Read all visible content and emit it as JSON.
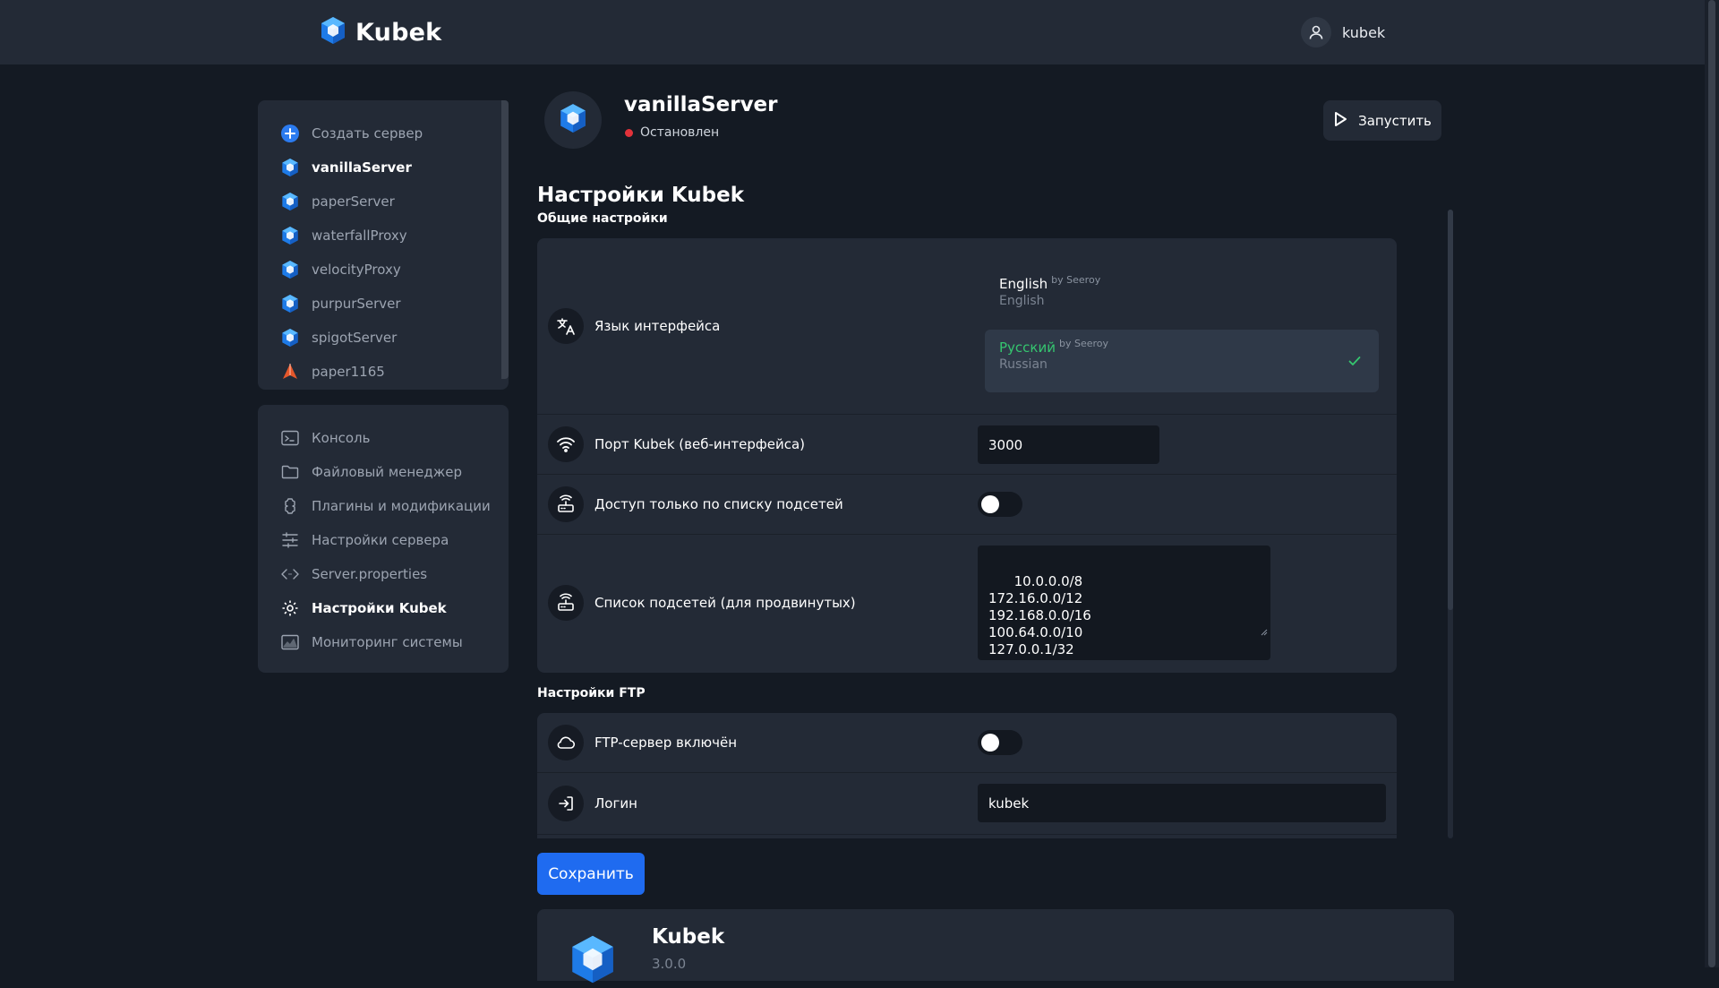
{
  "app": {
    "name": "Kubek",
    "user": "kubek"
  },
  "servers": [
    {
      "label": "Создать сервер",
      "icon": "plus-circle-icon"
    },
    {
      "label": "vanillaServer",
      "icon": "server-cube-icon",
      "active": true
    },
    {
      "label": "paperServer",
      "icon": "server-cube-icon"
    },
    {
      "label": "waterfallProxy",
      "icon": "server-cube-icon"
    },
    {
      "label": "velocityProxy",
      "icon": "server-cube-icon"
    },
    {
      "label": "purpurServer",
      "icon": "server-cube-icon"
    },
    {
      "label": "spigotServer",
      "icon": "server-cube-icon"
    },
    {
      "label": "paper1165",
      "icon": "paper-plane-icon"
    }
  ],
  "menu": [
    {
      "label": "Консоль",
      "icon": "console-icon"
    },
    {
      "label": "Файловый менеджер",
      "icon": "folder-icon"
    },
    {
      "label": "Плагины и модификации",
      "icon": "puzzle-icon"
    },
    {
      "label": "Настройки сервера",
      "icon": "sliders-icon"
    },
    {
      "label": "Server.properties",
      "icon": "code-icon"
    },
    {
      "label": "Настройки Kubek",
      "icon": "gear-icon",
      "active": true
    },
    {
      "label": "Мониторинг системы",
      "icon": "monitor-chart-icon"
    }
  ],
  "server": {
    "name": "vanillaServer",
    "status": "Остановлен",
    "status_color": "#e2323a",
    "run_label": "Запустить"
  },
  "settings": {
    "title": "Настройки Kubek",
    "general_title": "Общие настройки",
    "language": {
      "label": "Язык интерфейса",
      "options": [
        {
          "name": "English",
          "by": "by Seeroy",
          "sub": "English",
          "selected": false
        },
        {
          "name": "Русский",
          "by": "by Seeroy",
          "sub": "Russian",
          "selected": true
        }
      ]
    },
    "port": {
      "label": "Порт Kubek (веб-интерфейса)",
      "value": "3000"
    },
    "subnet_only": {
      "label": "Доступ только по списку подсетей",
      "enabled": false
    },
    "subnets": {
      "label": "Список подсетей (для продвинутых)",
      "value": "10.0.0.0/8\n172.16.0.0/12\n192.168.0.0/16\n100.64.0.0/10\n127.0.0.1/32"
    },
    "ftp_title": "Настройки FTP",
    "ftp_enabled": {
      "label": "FTP-сервер включён",
      "enabled": false
    },
    "login": {
      "label": "Логин",
      "value": "kubek"
    },
    "save_label": "Сохранить"
  },
  "about": {
    "title": "Kubek",
    "version": "3.0.0"
  },
  "colors": {
    "accent": "#1f6bf0",
    "success": "#35c66f",
    "panel": "#232a36",
    "background": "#141a23"
  }
}
